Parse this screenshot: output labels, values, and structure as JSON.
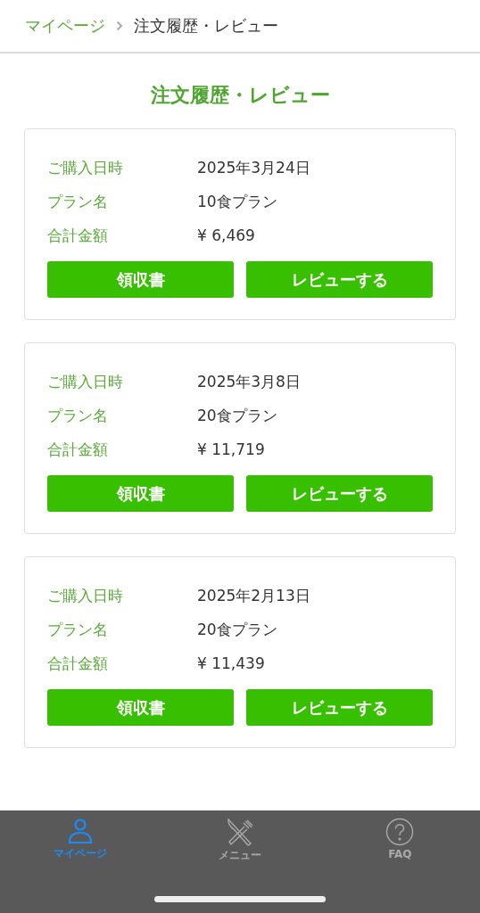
{
  "breadcrumb": {
    "items": [
      {
        "label": "マイページ",
        "link": true
      },
      {
        "label": "注文履歴・レビュー",
        "link": false
      }
    ]
  },
  "title": "注文履歴・レビュー",
  "orders": [
    {
      "fields": [
        {
          "label": "ご購入日時",
          "value": "2025年3月24日"
        },
        {
          "label": "プラン名",
          "value": "10食プラン"
        },
        {
          "label": "合計金額",
          "value": "¥ 6,469"
        }
      ],
      "buttons": [
        "領収書",
        "レビューする"
      ]
    },
    {
      "fields": [
        {
          "label": "ご購入日時",
          "value": "2025年3月8日"
        },
        {
          "label": "プラン名",
          "value": "20食プラン"
        },
        {
          "label": "合計金額",
          "value": "¥ 11,719"
        }
      ],
      "buttons": [
        "領収書",
        "レビューする"
      ]
    },
    {
      "fields": [
        {
          "label": "ご購入日時",
          "value": "2025年2月13日"
        },
        {
          "label": "プラン名",
          "value": "20食プラン"
        },
        {
          "label": "合計金額",
          "value": "¥ 11,439"
        }
      ],
      "buttons": [
        "領収書",
        "レビューする"
      ]
    }
  ],
  "tab_bar": {
    "items": [
      {
        "label": "マイページ",
        "kind": "person",
        "selected": true
      },
      {
        "label": "メニュー",
        "kind": "cutlery",
        "selected": false
      },
      {
        "label": "FAQ",
        "kind": "help",
        "selected": false
      }
    ]
  }
}
